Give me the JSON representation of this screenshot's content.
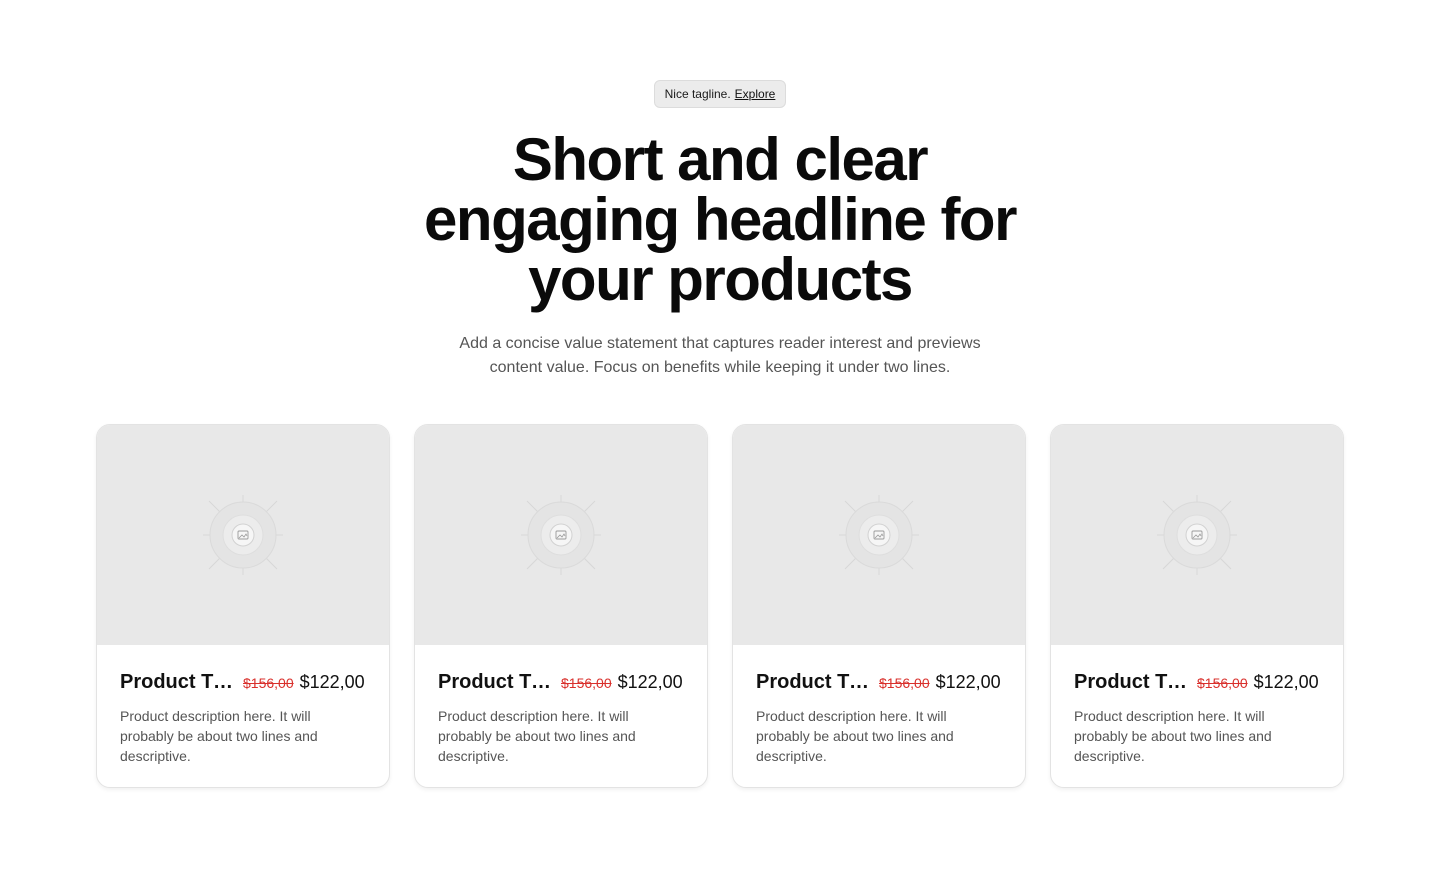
{
  "hero": {
    "tagline_text": "Nice tagline.",
    "tagline_link": "Explore",
    "headline": "Short and clear engaging headline for your products",
    "subtext": "Add a concise value statement that captures reader interest and previews content value. Focus on benefits while keeping it under two lines."
  },
  "products": [
    {
      "title": "Product Title",
      "old_price": "$156,00",
      "price": "$122,00",
      "description": "Product description here. It will probably be about two lines and descriptive.",
      "image_icon": "image-placeholder-icon"
    },
    {
      "title": "Product Title",
      "old_price": "$156,00",
      "price": "$122,00",
      "description": "Product description here. It will probably be about two lines and descriptive.",
      "image_icon": "image-placeholder-icon"
    },
    {
      "title": "Product Title",
      "old_price": "$156,00",
      "price": "$122,00",
      "description": "Product description here. It will probably be about two lines and descriptive.",
      "image_icon": "image-placeholder-icon"
    },
    {
      "title": "Product Title",
      "old_price": "$156,00",
      "price": "$122,00",
      "description": "Product description here. It will probably be about two lines and descriptive.",
      "image_icon": "image-placeholder-icon"
    }
  ],
  "colors": {
    "sale_price": "#d9302c",
    "image_placeholder": "#e8e8e8"
  }
}
